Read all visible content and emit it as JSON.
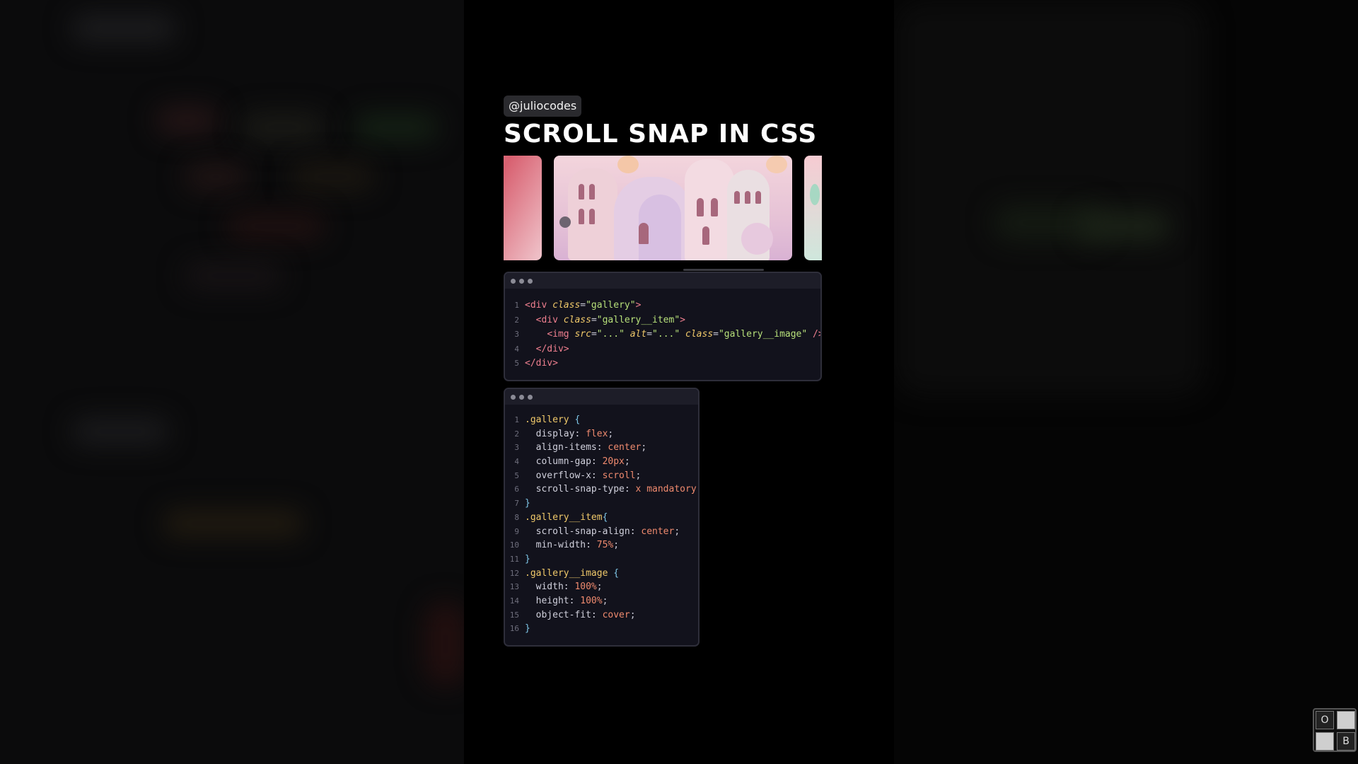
{
  "header": {
    "handle": "@juliocodes",
    "title": "SCROLL SNAP IN CSS"
  },
  "gallery": {
    "items": [
      "pink-rock-image",
      "pastel-castle-image",
      "mint-pastel-image"
    ]
  },
  "html_code": {
    "lines": [
      {
        "n": "1",
        "parts": [
          [
            "tag",
            "<div "
          ],
          [
            "attr",
            "class"
          ],
          [
            "pn",
            "="
          ],
          [
            "str",
            "\"gallery\""
          ],
          [
            "tag",
            ">"
          ]
        ]
      },
      {
        "n": "2",
        "parts": [
          [
            "pn",
            "  "
          ],
          [
            "tag",
            "<div "
          ],
          [
            "attr",
            "class"
          ],
          [
            "pn",
            "="
          ],
          [
            "str",
            "\"gallery__item\""
          ],
          [
            "tag",
            ">"
          ]
        ]
      },
      {
        "n": "3",
        "parts": [
          [
            "pn",
            "    "
          ],
          [
            "tag",
            "<img "
          ],
          [
            "attr",
            "src"
          ],
          [
            "pn",
            "="
          ],
          [
            "str",
            "\"...\" "
          ],
          [
            "attr",
            "alt"
          ],
          [
            "pn",
            "="
          ],
          [
            "str",
            "\"...\" "
          ],
          [
            "attr",
            "class"
          ],
          [
            "pn",
            "="
          ],
          [
            "str",
            "\"gallery__image\" "
          ],
          [
            "tag",
            "/>"
          ]
        ]
      },
      {
        "n": "4",
        "parts": [
          [
            "pn",
            "  "
          ],
          [
            "tag",
            "</div>"
          ]
        ]
      },
      {
        "n": "5",
        "parts": [
          [
            "tag",
            "</div>"
          ]
        ]
      }
    ]
  },
  "css_code": {
    "lines": [
      {
        "n": "1",
        "parts": [
          [
            "sel",
            ".gallery "
          ],
          [
            "br",
            "{"
          ]
        ]
      },
      {
        "n": "2",
        "parts": [
          [
            "prop",
            "  display: "
          ],
          [
            "val",
            "flex"
          ],
          [
            "pn",
            ";"
          ]
        ]
      },
      {
        "n": "3",
        "parts": [
          [
            "prop",
            "  align-items: "
          ],
          [
            "val",
            "center"
          ],
          [
            "pn",
            ";"
          ]
        ]
      },
      {
        "n": "4",
        "parts": [
          [
            "prop",
            "  column-gap: "
          ],
          [
            "val",
            "20px"
          ],
          [
            "pn",
            ";"
          ]
        ]
      },
      {
        "n": "5",
        "parts": [
          [
            "prop",
            "  overflow-x: "
          ],
          [
            "val",
            "scroll"
          ],
          [
            "pn",
            ";"
          ]
        ]
      },
      {
        "n": "6",
        "parts": [
          [
            "prop",
            "  scroll-snap-type: "
          ],
          [
            "val",
            "x mandatory"
          ],
          [
            "pn",
            ";"
          ]
        ]
      },
      {
        "n": "7",
        "parts": [
          [
            "br",
            "}"
          ]
        ]
      },
      {
        "n": "8",
        "parts": [
          [
            "sel",
            ".gallery__item"
          ],
          [
            "br",
            "{"
          ]
        ]
      },
      {
        "n": "9",
        "parts": [
          [
            "prop",
            "  scroll-snap-align: "
          ],
          [
            "val",
            "center"
          ],
          [
            "pn",
            ";"
          ]
        ]
      },
      {
        "n": "10",
        "parts": [
          [
            "prop",
            "  min-width: "
          ],
          [
            "val",
            "75%"
          ],
          [
            "pn",
            ";"
          ]
        ]
      },
      {
        "n": "11",
        "parts": [
          [
            "br",
            "}"
          ]
        ]
      },
      {
        "n": "12",
        "parts": [
          [
            "sel",
            ".gallery__image "
          ],
          [
            "br",
            "{"
          ]
        ]
      },
      {
        "n": "13",
        "parts": [
          [
            "prop",
            "  width: "
          ],
          [
            "val",
            "100%"
          ],
          [
            "pn",
            ";"
          ]
        ]
      },
      {
        "n": "14",
        "parts": [
          [
            "prop",
            "  height: "
          ],
          [
            "val",
            "100%"
          ],
          [
            "pn",
            ";"
          ]
        ]
      },
      {
        "n": "15",
        "parts": [
          [
            "prop",
            "  object-fit: "
          ],
          [
            "val",
            "cover"
          ],
          [
            "pn",
            ";"
          ]
        ]
      },
      {
        "n": "16",
        "parts": [
          [
            "br",
            "}"
          ]
        ]
      }
    ]
  },
  "corner_widget": {
    "top_left": "O",
    "bottom_right": "B"
  }
}
